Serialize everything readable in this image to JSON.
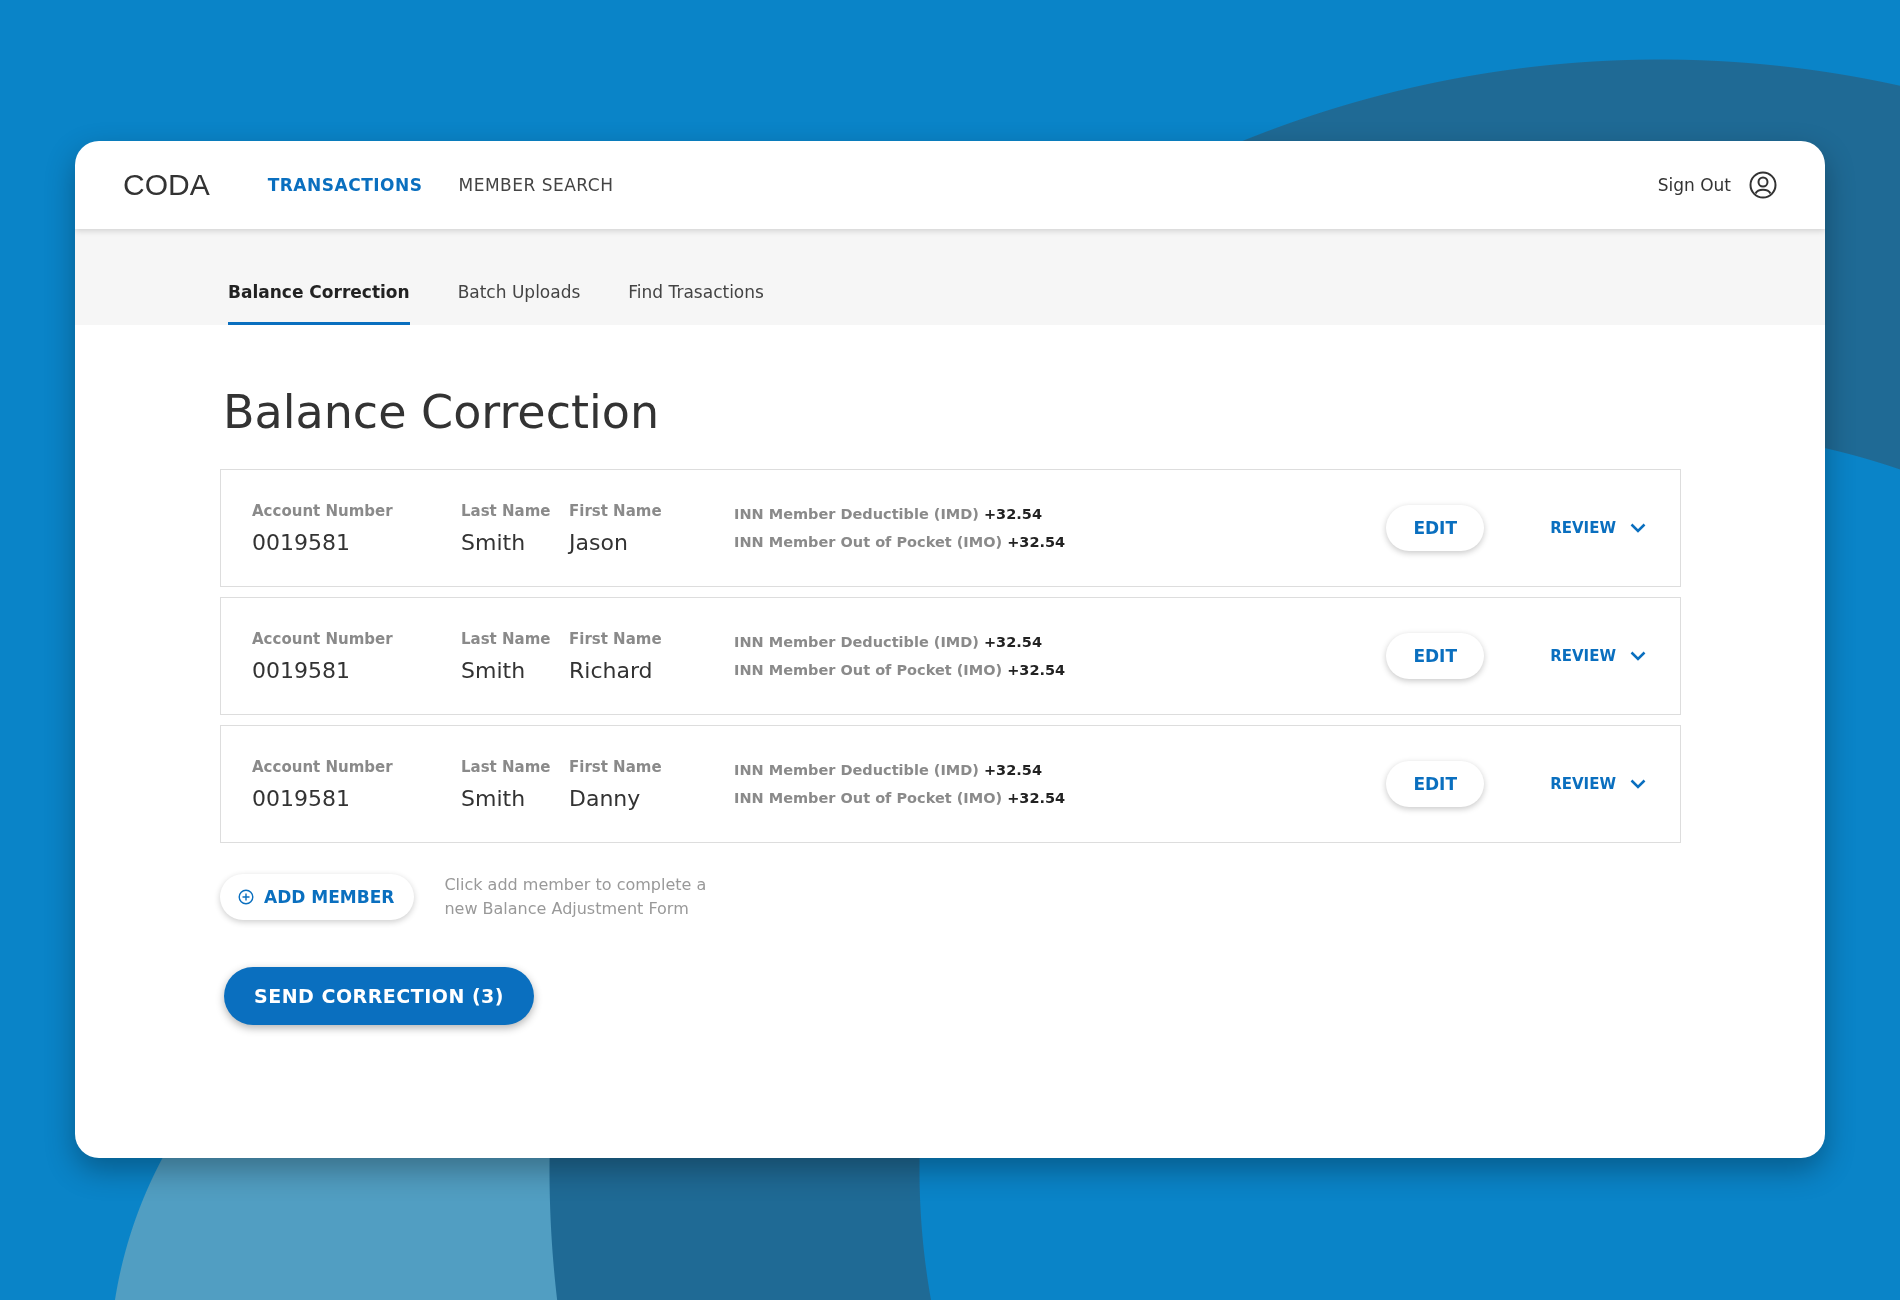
{
  "header": {
    "logo": "CODA",
    "nav": [
      {
        "label": "TRANSACTIONS",
        "selected": true
      },
      {
        "label": "MEMBER SEARCH",
        "selected": false
      }
    ],
    "sign_out": "Sign Out"
  },
  "subtabs": [
    {
      "label": "Balance Correction",
      "selected": true
    },
    {
      "label": "Batch Uploads",
      "selected": false
    },
    {
      "label": "Find Trasactions",
      "selected": false
    }
  ],
  "title": "Balance Correction",
  "rows": [
    {
      "fields": [
        {
          "label": "Account Number",
          "value": "0019581"
        },
        {
          "label": "Last Name",
          "value": "Smith"
        },
        {
          "label": "First Name",
          "value": "Jason"
        }
      ],
      "amounts": [
        {
          "label": "INN Member Deductible (IMD)",
          "value": "+32.54"
        },
        {
          "label": "INN Member Out of Pocket (IMO)",
          "value": "+32.54"
        }
      ],
      "edit": "EDIT",
      "review": "REVIEW"
    },
    {
      "fields": [
        {
          "label": "Account Number",
          "value": "0019581"
        },
        {
          "label": "Last Name",
          "value": "Smith"
        },
        {
          "label": "First Name",
          "value": "Richard"
        }
      ],
      "amounts": [
        {
          "label": "INN Member Deductible (IMD)",
          "value": "+32.54"
        },
        {
          "label": "INN Member Out of Pocket (IMO)",
          "value": "+32.54"
        }
      ],
      "edit": "EDIT",
      "review": "REVIEW"
    },
    {
      "fields": [
        {
          "label": "Account Number",
          "value": "0019581"
        },
        {
          "label": "Last Name",
          "value": "Smith"
        },
        {
          "label": "First Name",
          "value": "Danny"
        }
      ],
      "amounts": [
        {
          "label": "INN Member Deductible (IMD)",
          "value": "+32.54"
        },
        {
          "label": "INN Member Out of Pocket (IMO)",
          "value": "+32.54"
        }
      ],
      "edit": "EDIT",
      "review": "REVIEW"
    }
  ],
  "add_member": {
    "label": "ADD MEMBER",
    "hint": "Click add member to complete a new Balance Adjustment Form"
  },
  "send_button": "SEND CORRECTION (3)"
}
